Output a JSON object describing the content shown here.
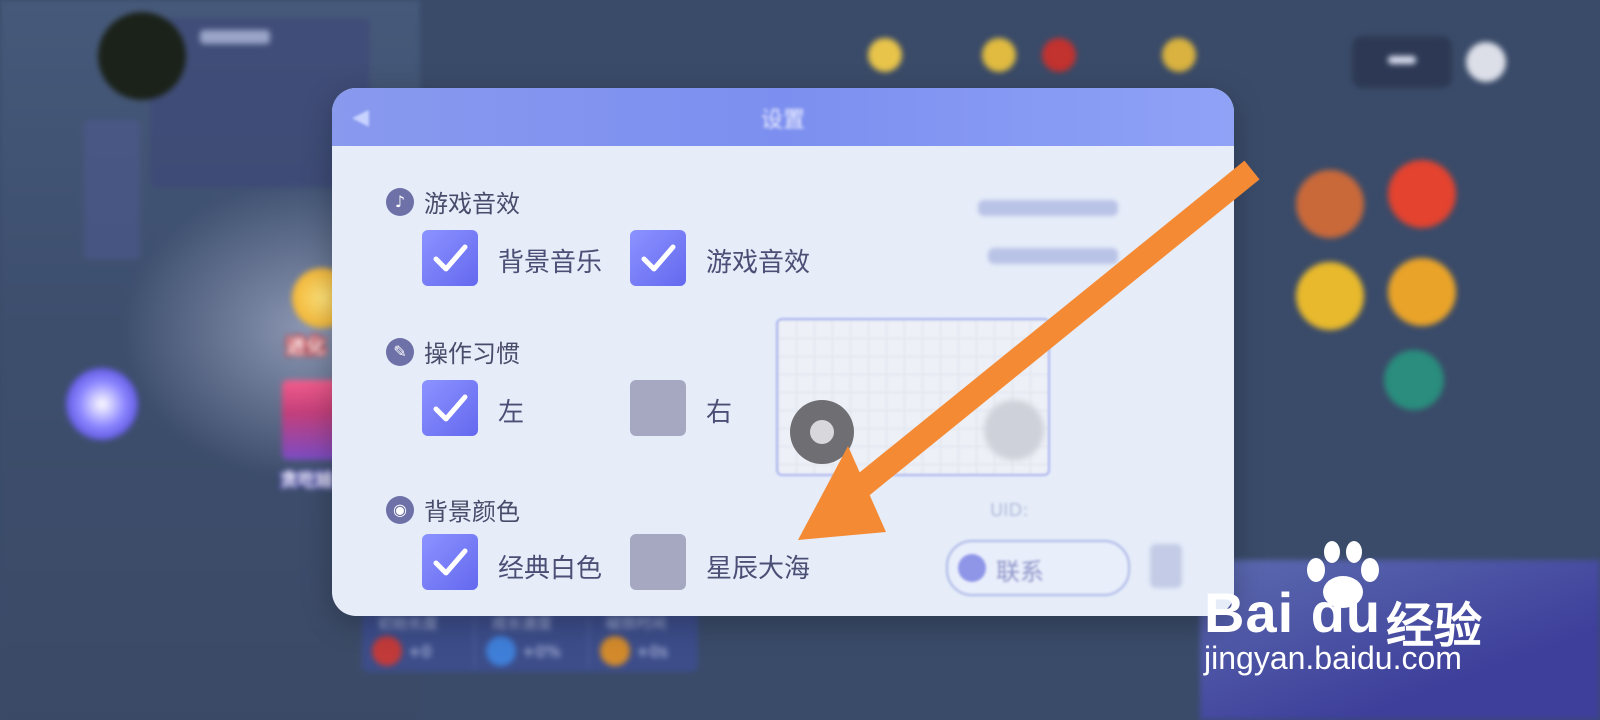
{
  "background": {
    "evolve_label": "进化",
    "shop_label": "贪吃娃",
    "stats": [
      {
        "label": "初始长度",
        "value": "+0",
        "icon": "snake-length-icon"
      },
      {
        "label": "成长速度",
        "value": "+0%",
        "icon": "lightning-icon"
      },
      {
        "label": "磁铁时间",
        "value": "+0s",
        "icon": "magnet-icon"
      }
    ]
  },
  "settings": {
    "title": "设置",
    "sound": {
      "title": "游戏音效",
      "options": [
        {
          "label": "背景音乐",
          "checked": true
        },
        {
          "label": "游戏音效",
          "checked": true
        }
      ]
    },
    "controls": {
      "title": "操作习惯",
      "options": [
        {
          "label": "左",
          "checked": true
        },
        {
          "label": "右",
          "checked": false
        }
      ]
    },
    "bg_color": {
      "title": "背景颜色",
      "options": [
        {
          "label": "经典白色",
          "checked": true
        },
        {
          "label": "星辰大海",
          "checked": false
        }
      ]
    },
    "uid_label": "UID:",
    "contact_label": "联系"
  },
  "watermark": {
    "brand": "Bai du",
    "product": "经验",
    "url": "jingyan.baidu.com"
  },
  "colors": {
    "accent": "#7c82f2",
    "arrow": "#f58a35",
    "modal_bg": "#e6edf9",
    "checkbox_off": "#a6a8c2"
  }
}
